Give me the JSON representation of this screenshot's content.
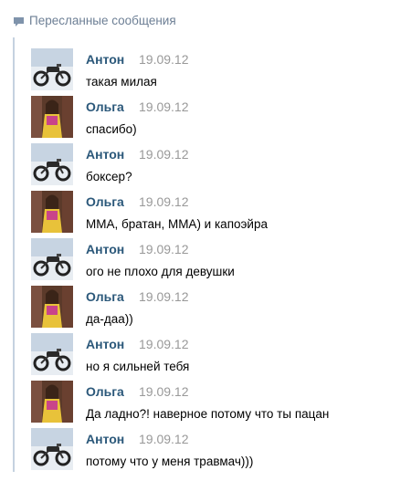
{
  "header": {
    "title": "Пересланные сообщения"
  },
  "messages": [
    {
      "author": "Антон",
      "date": "19.09.12",
      "text": "такая милая",
      "avatar": "motorcycle"
    },
    {
      "author": "Ольга",
      "date": "19.09.12",
      "text": "спасибо)",
      "avatar": "girl"
    },
    {
      "author": "Антон",
      "date": "19.09.12",
      "text": "боксер?",
      "avatar": "motorcycle"
    },
    {
      "author": "Ольга",
      "date": "19.09.12",
      "text": "ММА, братан, ММА) и капоэйра",
      "avatar": "girl"
    },
    {
      "author": "Антон",
      "date": "19.09.12",
      "text": "ого не плохо для девушки",
      "avatar": "motorcycle"
    },
    {
      "author": "Ольга",
      "date": "19.09.12",
      "text": "да-даа))",
      "avatar": "girl"
    },
    {
      "author": "Антон",
      "date": "19.09.12",
      "text": "но я сильней тебя",
      "avatar": "motorcycle"
    },
    {
      "author": "Ольга",
      "date": "19.09.12",
      "text": "Да ладно?! наверное потому что ты пацан",
      "avatar": "girl"
    },
    {
      "author": "Антон",
      "date": "19.09.12",
      "text": "потому что у меня травмач)))",
      "avatar": "motorcycle"
    }
  ],
  "colors": {
    "author": "#2b587a",
    "date": "#999999",
    "header": "#6d7f95",
    "thread_line": "#c5d2e0"
  }
}
